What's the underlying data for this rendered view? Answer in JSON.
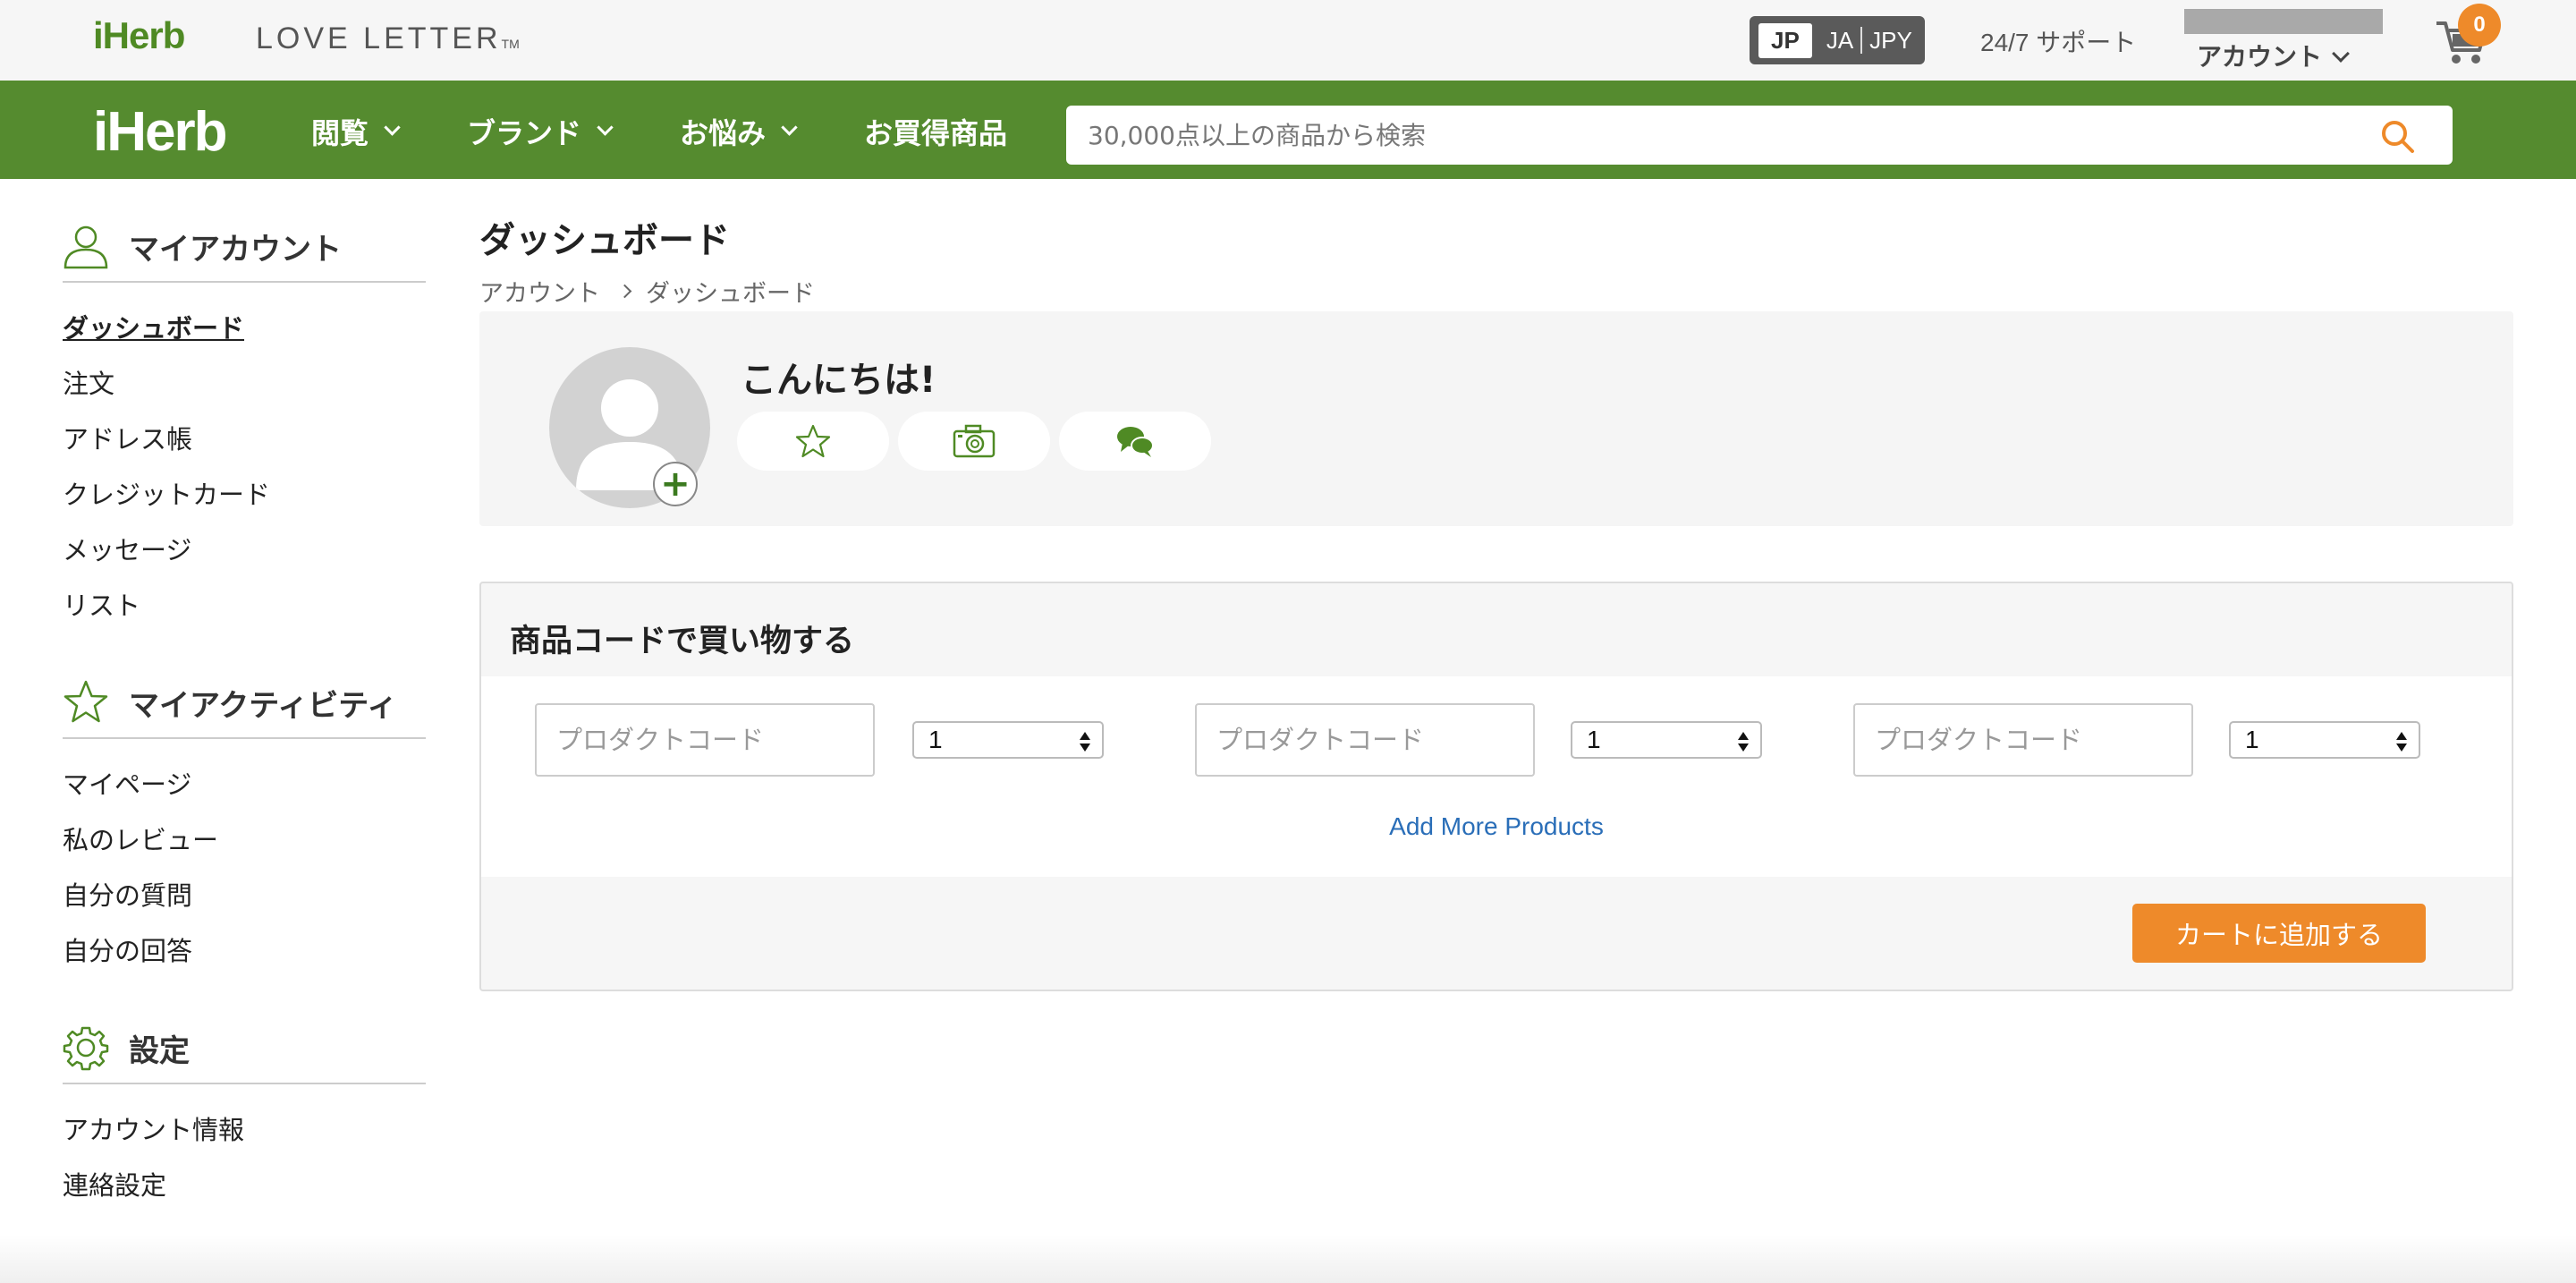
{
  "topbar": {
    "logo_small": "iHerb",
    "love_letter": "LOVE LETTER",
    "love_letter_tm": "TM",
    "locale": {
      "country": "JP",
      "language": "JA",
      "currency": "JPY"
    },
    "support": "24/7 サポート",
    "account": "アカウント",
    "cart_count": "0"
  },
  "navbar": {
    "logo": "iHerb",
    "items": [
      {
        "label": "閲覧"
      },
      {
        "label": "ブランド"
      },
      {
        "label": "お悩み"
      },
      {
        "label": "お買得商品"
      }
    ],
    "search_placeholder": "30,000点以上の商品から検索"
  },
  "sidebar": {
    "sections": [
      {
        "title": "マイアカウント",
        "items": [
          "ダッシュボード",
          "注文",
          "アドレス帳",
          "クレジットカード",
          "メッセージ",
          "リスト"
        ]
      },
      {
        "title": "マイアクティビティ",
        "items": [
          "マイページ",
          "私のレビュー",
          "自分の質問",
          "自分の回答"
        ]
      },
      {
        "title": "設定",
        "items": [
          "アカウント情報",
          "連絡設定"
        ]
      }
    ]
  },
  "main": {
    "page_title": "ダッシュボード",
    "breadcrumb": [
      "アカウント",
      "ダッシュボード"
    ],
    "profile": {
      "greeting": "こんにちは!"
    },
    "quick_order": {
      "title": "商品コードで買い物する",
      "code_placeholder": "プロダクトコード",
      "qty": [
        "1",
        "1",
        "1"
      ],
      "add_more": "Add More Products",
      "add_to_cart": "カートに追加する"
    }
  },
  "colors": {
    "brand_green": "#558b2f",
    "accent_orange": "#ee8a2a",
    "link_blue": "#2a6eb8"
  }
}
